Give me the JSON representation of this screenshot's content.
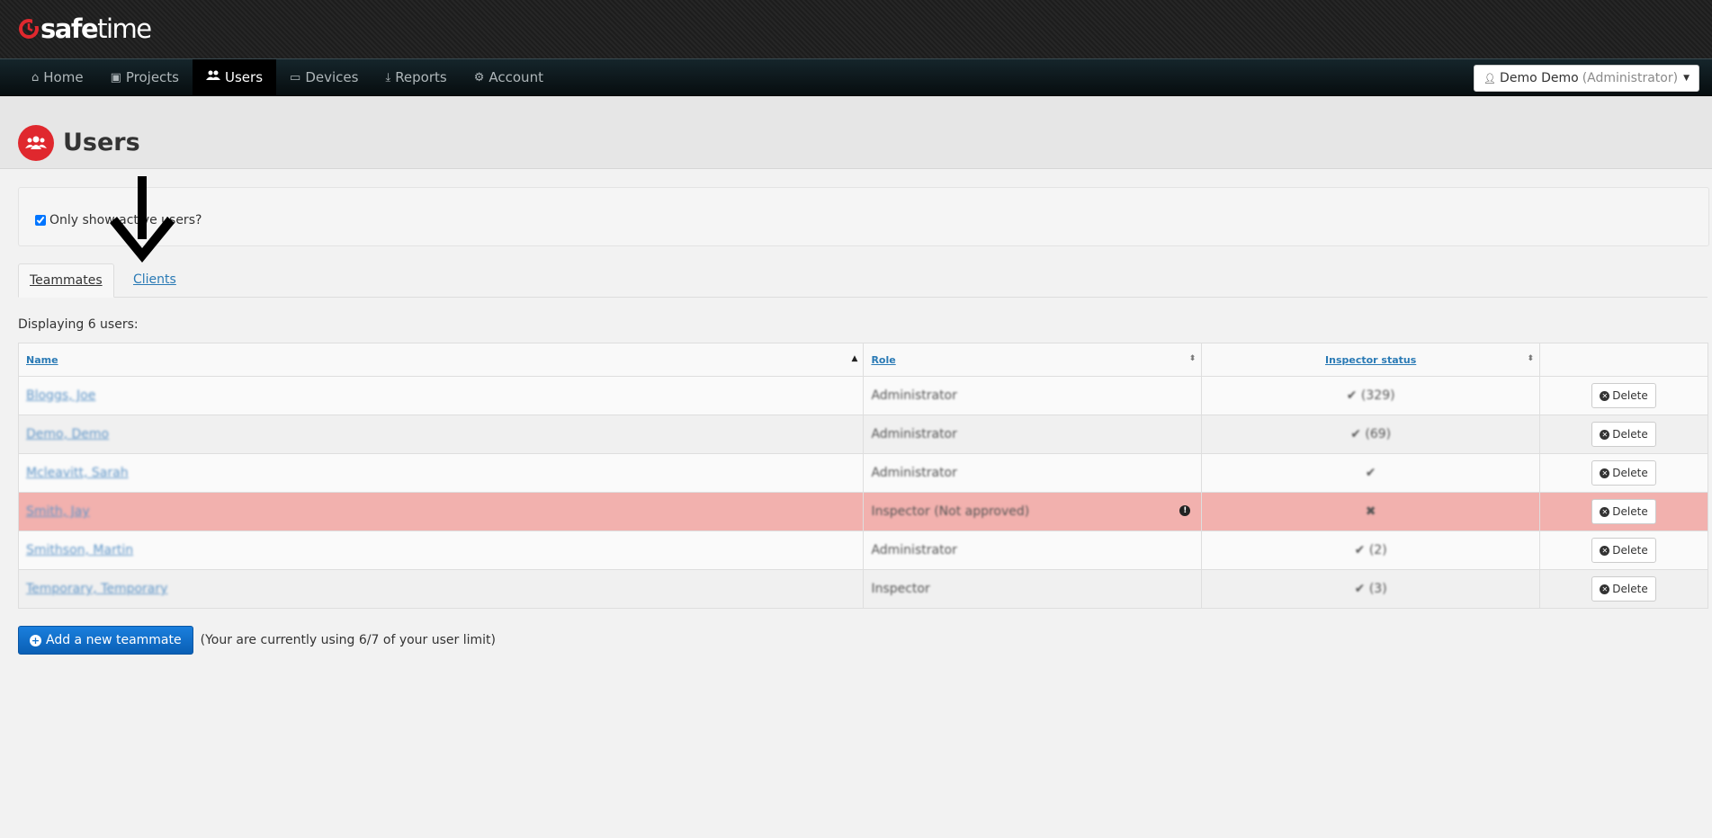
{
  "brand": {
    "name_bold": "safe",
    "name_light": "time",
    "accent": "#e0282e"
  },
  "nav": {
    "items": [
      {
        "label": "Home",
        "icon": "home-icon"
      },
      {
        "label": "Projects",
        "icon": "briefcase-icon"
      },
      {
        "label": "Users",
        "icon": "users-icon",
        "active": true
      },
      {
        "label": "Devices",
        "icon": "credit-card-icon"
      },
      {
        "label": "Reports",
        "icon": "download-icon"
      },
      {
        "label": "Account",
        "icon": "cogs-icon"
      }
    ],
    "user_menu": {
      "name": "Demo Demo",
      "role": "(Administrator)"
    }
  },
  "page": {
    "title": "Users",
    "icon": "users-icon"
  },
  "filter": {
    "active_only_label": "Only show active users?",
    "active_only_checked": true
  },
  "tabs": [
    {
      "label": "Teammates",
      "active": true
    },
    {
      "label": "Clients",
      "active": false
    }
  ],
  "display_count": "Displaying 6 users:",
  "table": {
    "headers": {
      "name": "Name",
      "role": "Role",
      "status": "Inspector status"
    },
    "delete_label": "Delete",
    "rows": [
      {
        "name": "Bloggs, Joe",
        "role": "Administrator",
        "status": "✔ (329)",
        "highlight": false
      },
      {
        "name": "Demo, Demo",
        "role": "Administrator",
        "status": "✔ (69)",
        "highlight": false
      },
      {
        "name": "Mcleavitt, Sarah",
        "role": "Administrator",
        "status": "✔",
        "highlight": false
      },
      {
        "name": "Smith, Jay",
        "role": "Inspector (Not approved)",
        "status": "✖",
        "highlight": true
      },
      {
        "name": "Smithson, Martin",
        "role": "Administrator",
        "status": "✔ (2)",
        "highlight": false
      },
      {
        "name": "Temporary, Temporary",
        "role": "Inspector",
        "status": "✔ (3)",
        "highlight": false
      }
    ]
  },
  "footer": {
    "add_button": "Add a new teammate",
    "limit_note": "(Your are currently using 6/7 of your user limit)"
  }
}
